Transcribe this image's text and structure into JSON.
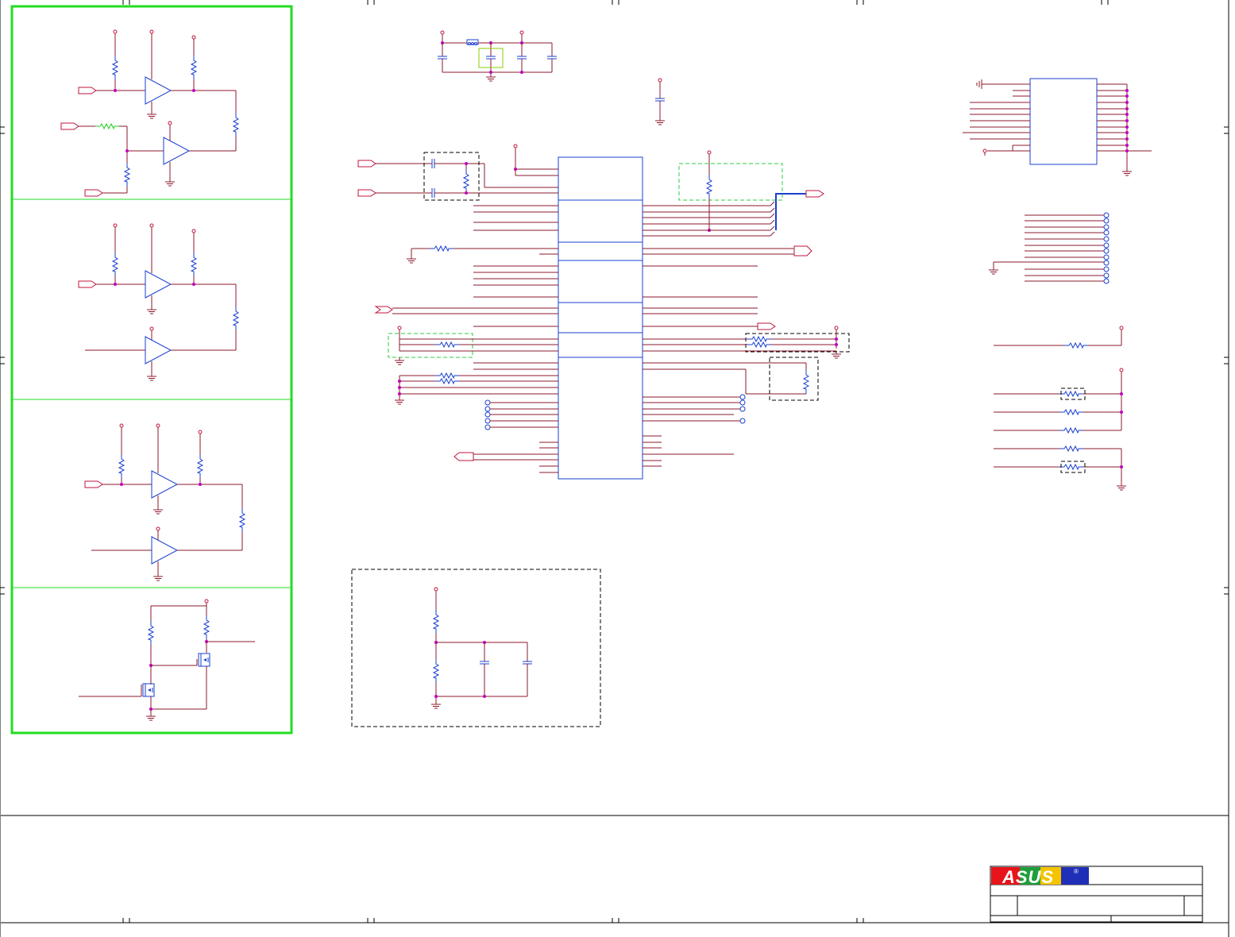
{
  "title_block": {
    "logo_text": "ASUS",
    "registered_mark": "®",
    "brand_colors": {
      "red": "#e8141c",
      "green": "#1f9e3a",
      "yellow": "#f4c400",
      "blue": "#1f2fb8"
    }
  },
  "colors": {
    "wire": "#8b1a2b",
    "component": "#1a3fd0",
    "net_dot": "#c000c0",
    "power_flag": "#c0143c",
    "highlight_box": "#22dd22",
    "frame": "#000000"
  },
  "icons": [
    "ground-icon",
    "power-flag-icon",
    "resistor-icon",
    "capacitor-icon",
    "opamp-icon",
    "mosfet-icon",
    "connector-pin-icon",
    "port-arrow-icon"
  ]
}
